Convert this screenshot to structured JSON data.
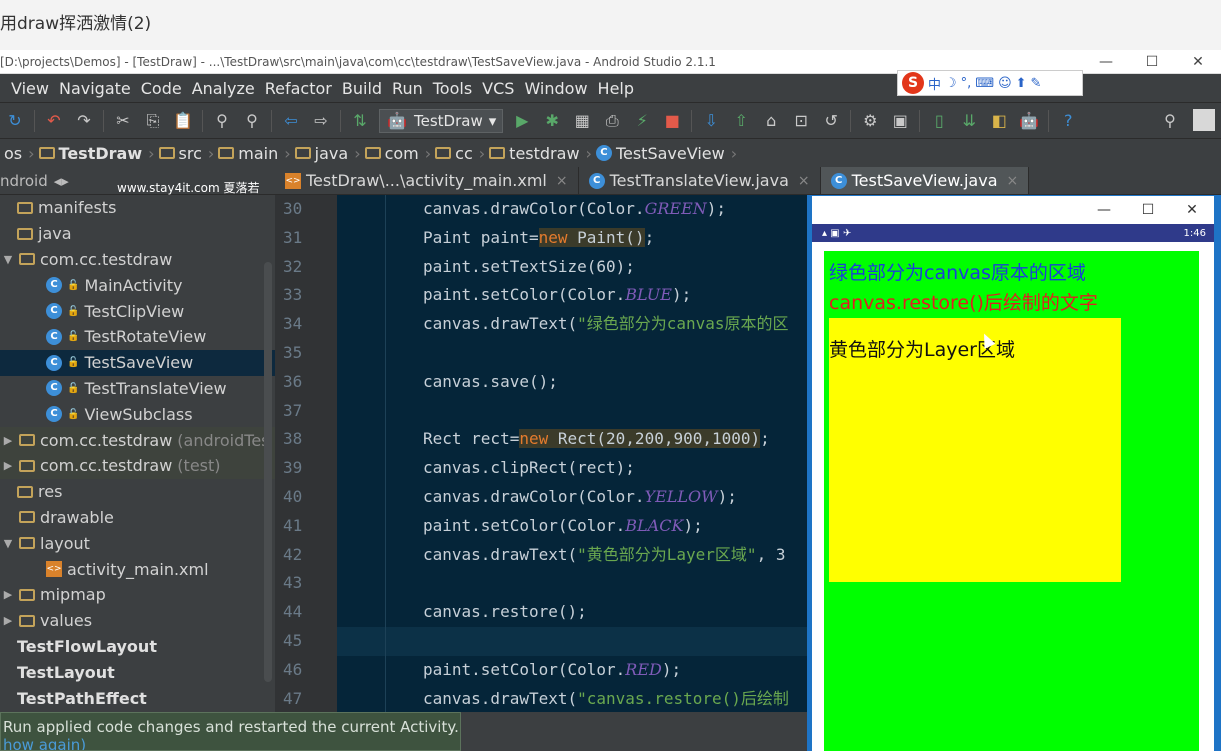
{
  "video_title": "用draw挥洒激情(2)",
  "window_title": "[D:\\projects\\Demos] - [TestDraw] - ...\\TestDraw\\src\\main\\java\\com\\cc\\testdraw\\TestSaveView.java - Android Studio 2.1.1",
  "window_controls": [
    "—",
    "☐",
    "✕"
  ],
  "menu": [
    "View",
    "Navigate",
    "Code",
    "Analyze",
    "Refactor",
    "Build",
    "Run",
    "Tools",
    "VCS",
    "Window",
    "Help"
  ],
  "ime": {
    "logo": "S",
    "mode": "中"
  },
  "toolbar": {
    "run_config": "TestDraw"
  },
  "breadcrumbs": [
    "os",
    "TestDraw",
    "src",
    "main",
    "java",
    "com",
    "cc",
    "testdraw",
    "TestSaveView"
  ],
  "project_panel": {
    "view": "ndroid",
    "watermark": "www.stay4it.com 夏落若",
    "items": [
      {
        "label": "manifests",
        "indent": 0
      },
      {
        "label": "java",
        "indent": 0
      },
      {
        "label": "com.cc.testdraw",
        "indent": 1
      },
      {
        "label": "MainActivity",
        "indent": 2
      },
      {
        "label": "TestClipView",
        "indent": 2
      },
      {
        "label": "TestRotateView",
        "indent": 2
      },
      {
        "label": "TestSaveView",
        "indent": 2
      },
      {
        "label": "TestTranslateView",
        "indent": 2
      },
      {
        "label": "ViewSubclass",
        "indent": 2
      },
      {
        "label": "com.cc.testdraw",
        "suffix": "(androidTes",
        "indent": 1
      },
      {
        "label": "com.cc.testdraw",
        "suffix": "(test)",
        "indent": 1
      },
      {
        "label": "res",
        "indent": 0
      },
      {
        "label": "drawable",
        "indent": 1
      },
      {
        "label": "layout",
        "indent": 1
      },
      {
        "label": "activity_main.xml",
        "indent": 2
      },
      {
        "label": "mipmap",
        "indent": 1
      },
      {
        "label": "values",
        "indent": 1
      },
      {
        "label": "TestFlowLayout",
        "indent": 0
      },
      {
        "label": "TestLayout",
        "indent": 0
      },
      {
        "label": "TestPathEffect",
        "indent": 0
      }
    ]
  },
  "tabs": [
    "TestDraw\\...\\activity_main.xml",
    "TestTranslateView.java",
    "TestSaveView.java"
  ],
  "code": {
    "line_numbers": [
      "30",
      "31",
      "32",
      "33",
      "34",
      "35",
      "36",
      "37",
      "38",
      "39",
      "40",
      "41",
      "42",
      "43",
      "44",
      "45",
      "46",
      "47"
    ],
    "l30": {
      "a": "canvas.drawColor(Color.",
      "c": "GREEN",
      "b": ");"
    },
    "l31": {
      "a": "Paint paint=",
      "k": "new",
      "b": " Paint()",
      "e": ";"
    },
    "l32": {
      "a": "paint.setTextSize(60);"
    },
    "l33": {
      "a": "paint.setColor(Color.",
      "c": "BLUE",
      "b": ");"
    },
    "l34": {
      "a": "canvas.drawText(",
      "s": "\"绿色部分为canvas原本的区"
    },
    "l36": {
      "a": "canvas.save();"
    },
    "l38": {
      "a": "Rect rect=",
      "k": "new",
      "b": " Rect(20,200,900,1000)",
      "e": ";"
    },
    "l39": {
      "a": "canvas.clipRect(rect);"
    },
    "l40": {
      "a": "canvas.drawColor(Color.",
      "c": "YELLOW",
      "b": ");"
    },
    "l41": {
      "a": "paint.setColor(Color.",
      "c": "BLACK",
      "b": ");"
    },
    "l42": {
      "a": "canvas.drawText(",
      "s": "\"黄色部分为Layer区域\"",
      "b": ", 3"
    },
    "l44": {
      "a": "canvas.restore();"
    },
    "l46": {
      "a": "paint.setColor(Color.",
      "c": "RED",
      "b": ");"
    },
    "l47": {
      "a": "canvas.drawText(",
      "s": "\"canvas.restore()后绘制"
    }
  },
  "emulator": {
    "status_time": "1:46",
    "text_blue": "绿色部分为canvas原本的区域",
    "text_red": "canvas.restore()后绘制的文字",
    "text_black": "黄色部分为Layer区域"
  },
  "toast": {
    "line1": "Run applied code changes and restarted the current Activity.",
    "line2": "how again)"
  },
  "colors": {
    "canvas_green": "#00ff00",
    "layer_yellow": "#ffff00",
    "text_blue": "#1a3fd8",
    "text_red": "#e02020"
  }
}
